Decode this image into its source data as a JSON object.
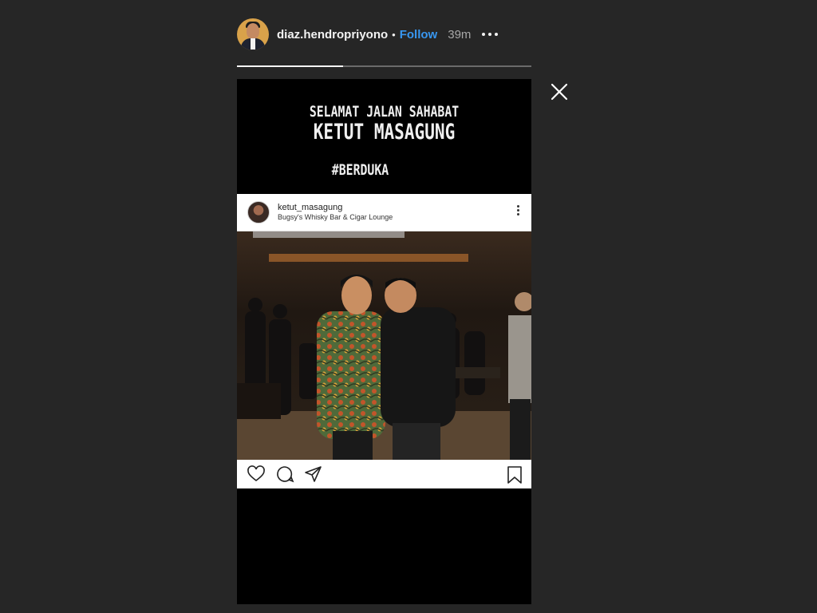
{
  "header": {
    "username": "diaz.hendropriyono",
    "separator": "•",
    "follow_label": "Follow",
    "time_ago": "39m"
  },
  "progress": {
    "value": 0.36
  },
  "story": {
    "line1": "SELAMAT JALAN SAHABAT",
    "line2": "KETUT MASAGUNG",
    "line3": "#BERDUKA",
    "post": {
      "username": "ketut_masagung",
      "location": "Bugsy's Whisky Bar & Cigar Lounge"
    }
  },
  "icons": {
    "more": "more-horizontal-icon",
    "close": "close-icon",
    "post_menu": "more-vertical-icon",
    "like": "heart-icon",
    "comment": "comment-icon",
    "share": "send-icon",
    "save": "bookmark-icon"
  },
  "colors": {
    "background": "#262626",
    "follow": "#3897f0",
    "story_bg": "#000000"
  }
}
